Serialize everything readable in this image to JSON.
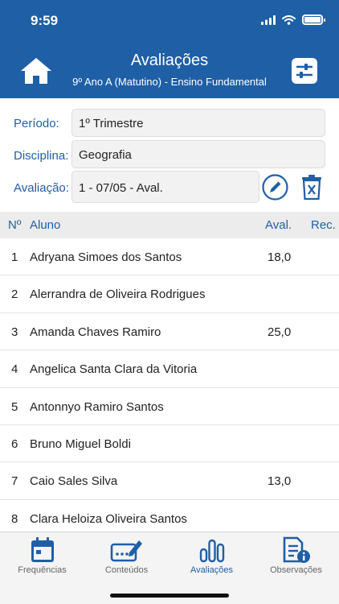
{
  "status_bar": {
    "time": "9:59",
    "battery_level": 1.0
  },
  "header": {
    "title": "Avaliações",
    "subtitle": "9º Ano A (Matutino) - Ensino Fundamental",
    "home_icon": "home-icon",
    "settings_icon": "sliders-icon"
  },
  "filters": {
    "periodo_label": "Período:",
    "periodo_value": "1º Trimestre",
    "disciplina_label": "Disciplina:",
    "disciplina_value": "Geografia",
    "avaliacao_label": "Avaliação:",
    "avaliacao_value": "1 - 07/05 - Aval.",
    "edit_icon": "pencil-icon",
    "delete_icon": "trash-icon"
  },
  "table": {
    "headers": {
      "no": "Nº",
      "aluno": "Aluno",
      "aval": "Aval.",
      "rec": "Rec."
    },
    "rows": [
      {
        "no": "1",
        "aluno": "Adryana Simoes dos Santos",
        "aval": "18,0",
        "rec": ""
      },
      {
        "no": "2",
        "aluno": "Alerrandra de Oliveira Rodrigues",
        "aval": "",
        "rec": ""
      },
      {
        "no": "3",
        "aluno": "Amanda Chaves Ramiro",
        "aval": "25,0",
        "rec": ""
      },
      {
        "no": "4",
        "aluno": "Angelica Santa Clara da Vitoria",
        "aval": "",
        "rec": ""
      },
      {
        "no": "5",
        "aluno": "Antonnyo Ramiro Santos",
        "aval": "",
        "rec": ""
      },
      {
        "no": "6",
        "aluno": "Bruno Miguel Boldi",
        "aval": "",
        "rec": ""
      },
      {
        "no": "7",
        "aluno": "Caio Sales Silva",
        "aval": "13,0",
        "rec": ""
      },
      {
        "no": "8",
        "aluno": "Clara Heloiza Oliveira Santos",
        "aval": "",
        "rec": ""
      }
    ]
  },
  "tabs": [
    {
      "label": "Frequências",
      "icon": "calendar-icon",
      "active": false
    },
    {
      "label": "Conteúdos",
      "icon": "content-edit-icon",
      "active": false
    },
    {
      "label": "Avaliações",
      "icon": "bar-chart-icon",
      "active": true
    },
    {
      "label": "Observações",
      "icon": "document-info-icon",
      "active": false
    }
  ],
  "colors": {
    "brand": "#1f5fa6",
    "header_bg": "#1f5fa6",
    "field_bg": "#f2f2f2",
    "table_head_bg": "#ececec"
  }
}
